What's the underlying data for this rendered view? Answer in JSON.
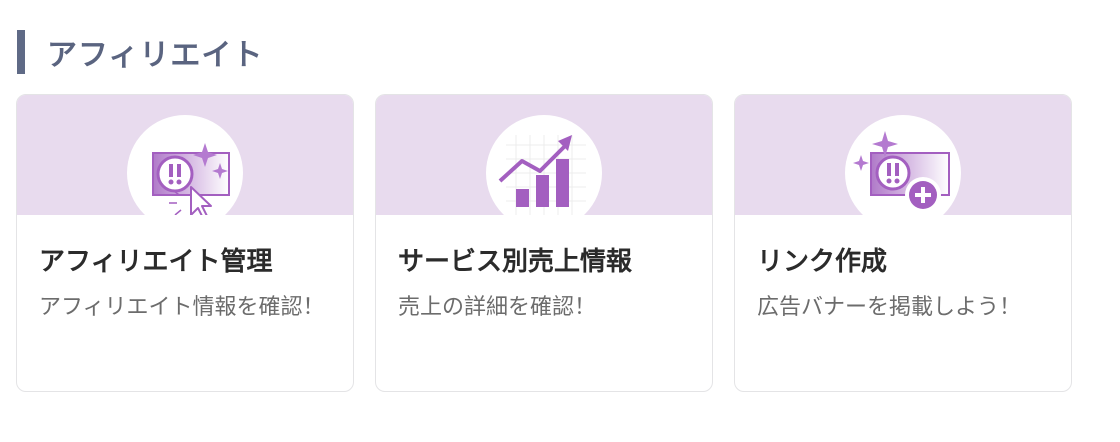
{
  "section": {
    "title": "アフィリエイト"
  },
  "cards": [
    {
      "title": "アフィリエイト管理",
      "description": "アフィリエイト情報を確認！",
      "icon": "affiliate-management-icon"
    },
    {
      "title": "サービス別売上情報",
      "description": "売上の詳細を確認！",
      "icon": "sales-chart-icon"
    },
    {
      "title": "リンク作成",
      "description": "広告バナーを掲載しよう！",
      "icon": "link-create-icon"
    }
  ],
  "colors": {
    "accent_bar": "#5f6a86",
    "card_top": "#e8dbee",
    "icon_purple": "#a35fc0"
  }
}
